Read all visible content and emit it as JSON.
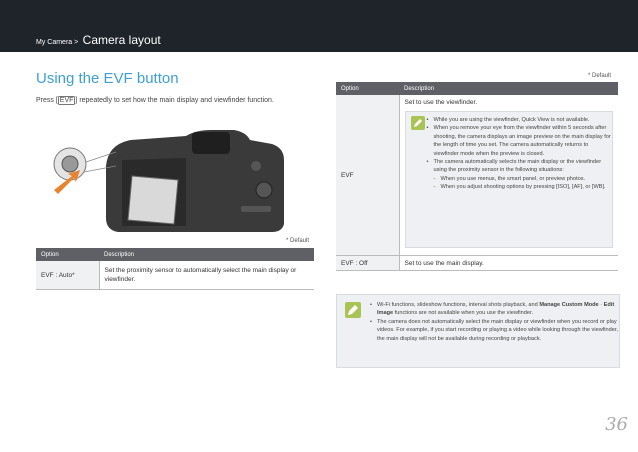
{
  "header": {
    "section": "My Camera >",
    "title": "Camera layout"
  },
  "left": {
    "heading": "Using the EVF button",
    "intro_before": "Press",
    "intro_key": "EVF",
    "intro_after": "repeatedly to set how the main display and viewfinder function.",
    "default_note": "* Default",
    "table": {
      "headers": [
        "Option",
        "Description"
      ],
      "rows": [
        {
          "option": "EVF : Auto*",
          "description": "Set the proximity sensor to automatically select the main display or viewfinder."
        }
      ]
    }
  },
  "right": {
    "default_note": "* Default",
    "table": {
      "headers": [
        "Option",
        "Description"
      ],
      "evf_option": "EVF",
      "evf_description": "Set to use the viewfinder.",
      "evf_notes": [
        "While you are using the viewfinder, Quick View is not available.",
        "When you remove your eye from the viewfinder within 5 seconds after shooting, the camera displays an image preview on the main display for the length of time you set. The camera automatically returns to viewfinder mode when the preview is closed.",
        "The camera automatically selects the main display or the viewfinder using the proximity sensor in the following situations:"
      ],
      "evf_subnotes": [
        "When you use menus, the smart panel, or preview photos.",
        "When you adjust shooting options by pressing [ISO], [AF], or [WB]."
      ],
      "off_option": "EVF : Off",
      "off_description": "Set to use the main display."
    }
  },
  "bottom_note": {
    "item1_prefix": "Wi-Fi functions, slideshow functions, interval shots playback, and",
    "item1_bold": "Manage Custom Mode",
    "item1_sep": " · ",
    "item1_bold2": "Edit Image",
    "item1_suffix": "functions are not available when you use the viewfinder.",
    "item2": "The camera does not automatically select the main display or viewfinder when you record or play videos. For example, if you start recording or playing a video while looking through the viewfinder, the main display will not be available during recording or playback."
  },
  "page_number": "36",
  "colors": {
    "header_bg": "#1f232a",
    "accent": "#3e9fd0",
    "table_header": "#5e6066",
    "note_icon": "#a9c455"
  },
  "icons": [
    "camera-illustration",
    "pencil-note-icon"
  ]
}
